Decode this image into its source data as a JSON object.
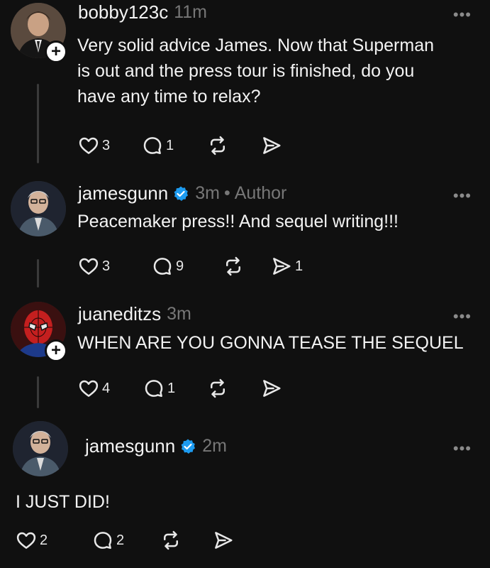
{
  "replies": [
    {
      "username": "bobby123c",
      "time": "11m",
      "text_lines": [
        "Very solid advice James. Now that Superman",
        "is out and the press tour is finished, do you",
        "have any time to relax?"
      ],
      "likes": "3",
      "comments": "1",
      "reposts": "",
      "shares": "",
      "more": "•••"
    },
    {
      "username": "jamesgunn",
      "verified": true,
      "time": "3m",
      "separator": "•",
      "role": "Author",
      "text": "Peacemaker press!! And sequel writing!!!",
      "likes": "3",
      "comments": "9",
      "reposts": "",
      "shares": "1",
      "more": "•••"
    },
    {
      "username": "juaneditzs",
      "time": "3m",
      "text": "WHEN ARE YOU GONNA TEASE THE SEQUEL",
      "likes": "4",
      "comments": "1",
      "reposts": "",
      "shares": "",
      "more": "•••"
    },
    {
      "username": "jamesgunn",
      "verified": true,
      "time": "2m",
      "text": "I JUST DID!",
      "likes": "2",
      "comments": "2",
      "reposts": "",
      "shares": "",
      "more": "•••"
    }
  ],
  "plus": "+",
  "colors": {
    "background": "#101010",
    "verified": "#1d9bf0",
    "muted": "#777777"
  }
}
